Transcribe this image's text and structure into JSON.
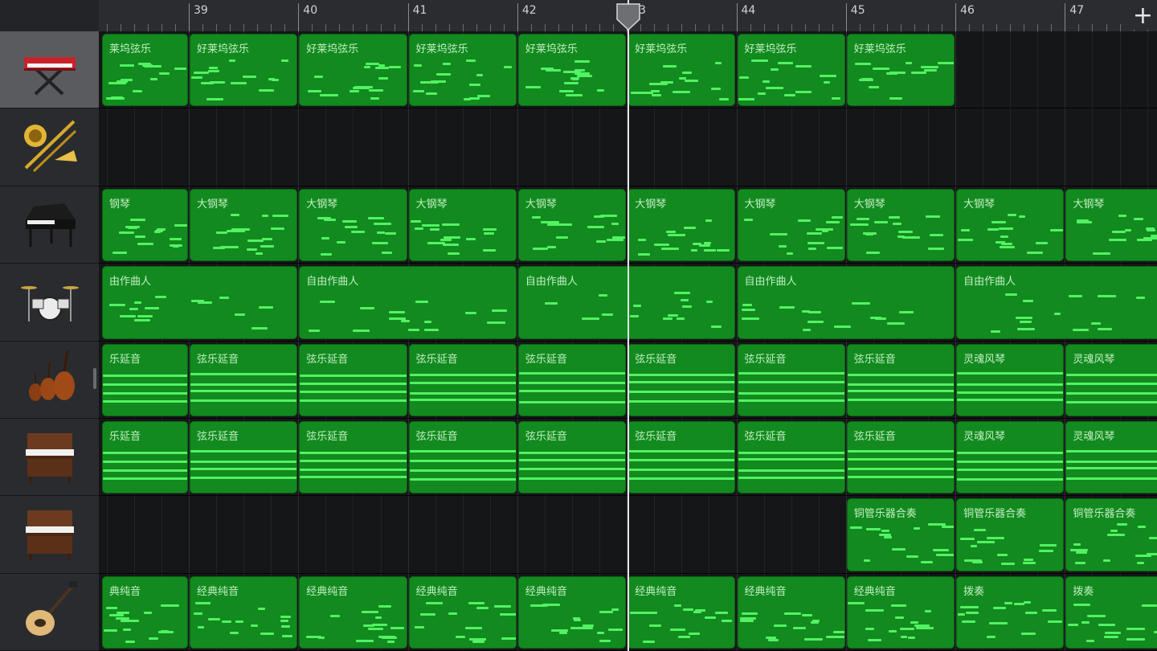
{
  "header": {
    "add_label": "+"
  },
  "ruler": {
    "bars": [
      "39",
      "40",
      "41",
      "42",
      "43",
      "44",
      "45",
      "46",
      "47"
    ]
  },
  "tracks": [
    {
      "icon": "keyboard-stand-icon",
      "selected": true
    },
    {
      "icon": "brass-instruments-icon",
      "selected": false
    },
    {
      "icon": "grand-piano-icon",
      "selected": false
    },
    {
      "icon": "drum-kit-icon",
      "selected": false
    },
    {
      "icon": "string-ensemble-icon",
      "selected": false
    },
    {
      "icon": "organ-icon",
      "selected": false
    },
    {
      "icon": "organ-icon",
      "selected": false
    },
    {
      "icon": "electric-guitar-icon",
      "selected": false
    }
  ],
  "regions": [
    [
      {
        "label": "莱坞弦乐",
        "start": 38.2,
        "end": 39
      },
      {
        "label": "好莱坞弦乐",
        "start": 39,
        "end": 40
      },
      {
        "label": "好莱坞弦乐",
        "start": 40,
        "end": 41
      },
      {
        "label": "好莱坞弦乐",
        "start": 41,
        "end": 42
      },
      {
        "label": "好莱坞弦乐",
        "start": 42,
        "end": 43
      },
      {
        "label": "好莱坞弦乐",
        "start": 43,
        "end": 44
      },
      {
        "label": "好莱坞弦乐",
        "start": 44,
        "end": 45
      },
      {
        "label": "好莱坞弦乐",
        "start": 45,
        "end": 46
      }
    ],
    [],
    [
      {
        "label": "钢琴",
        "start": 38.2,
        "end": 39
      },
      {
        "label": "大钢琴",
        "start": 39,
        "end": 40
      },
      {
        "label": "大钢琴",
        "start": 40,
        "end": 41
      },
      {
        "label": "大钢琴",
        "start": 41,
        "end": 42
      },
      {
        "label": "大钢琴",
        "start": 42,
        "end": 43
      },
      {
        "label": "大钢琴",
        "start": 43,
        "end": 44
      },
      {
        "label": "大钢琴",
        "start": 44,
        "end": 45
      },
      {
        "label": "大钢琴",
        "start": 45,
        "end": 46
      },
      {
        "label": "大钢琴",
        "start": 46,
        "end": 47
      },
      {
        "label": "大钢琴",
        "start": 47,
        "end": 48
      }
    ],
    [
      {
        "label": "由作曲人",
        "start": 38.2,
        "end": 40
      },
      {
        "label": "自由作曲人",
        "start": 40,
        "end": 42
      },
      {
        "label": "自由作曲人",
        "start": 42,
        "end": 44
      },
      {
        "label": "自由作曲人",
        "start": 44,
        "end": 46
      },
      {
        "label": "自由作曲人",
        "start": 46,
        "end": 48
      }
    ],
    [
      {
        "label": "乐延音",
        "start": 38.2,
        "end": 39
      },
      {
        "label": "弦乐延音",
        "start": 39,
        "end": 40
      },
      {
        "label": "弦乐延音",
        "start": 40,
        "end": 41
      },
      {
        "label": "弦乐延音",
        "start": 41,
        "end": 42
      },
      {
        "label": "弦乐延音",
        "start": 42,
        "end": 43
      },
      {
        "label": "弦乐延音",
        "start": 43,
        "end": 44
      },
      {
        "label": "弦乐延音",
        "start": 44,
        "end": 45
      },
      {
        "label": "弦乐延音",
        "start": 45,
        "end": 46
      },
      {
        "label": "灵魂风琴",
        "start": 46,
        "end": 47
      },
      {
        "label": "灵魂风琴",
        "start": 47,
        "end": 48
      }
    ],
    [
      {
        "label": "乐延音",
        "start": 38.2,
        "end": 39
      },
      {
        "label": "弦乐延音",
        "start": 39,
        "end": 40
      },
      {
        "label": "弦乐延音",
        "start": 40,
        "end": 41
      },
      {
        "label": "弦乐延音",
        "start": 41,
        "end": 42
      },
      {
        "label": "弦乐延音",
        "start": 42,
        "end": 43
      },
      {
        "label": "弦乐延音",
        "start": 43,
        "end": 44
      },
      {
        "label": "弦乐延音",
        "start": 44,
        "end": 45
      },
      {
        "label": "弦乐延音",
        "start": 45,
        "end": 46
      },
      {
        "label": "灵魂风琴",
        "start": 46,
        "end": 47
      },
      {
        "label": "灵魂风琴",
        "start": 47,
        "end": 48
      }
    ],
    [
      {
        "label": "铜管乐器合奏",
        "start": 45,
        "end": 46
      },
      {
        "label": "铜管乐器合奏",
        "start": 46,
        "end": 47
      },
      {
        "label": "铜管乐器合奏",
        "start": 47,
        "end": 48
      }
    ],
    [
      {
        "label": "典纯音",
        "start": 38.2,
        "end": 39
      },
      {
        "label": "经典纯音",
        "start": 39,
        "end": 40
      },
      {
        "label": "经典纯音",
        "start": 40,
        "end": 41
      },
      {
        "label": "经典纯音",
        "start": 41,
        "end": 42
      },
      {
        "label": "经典纯音",
        "start": 42,
        "end": 43
      },
      {
        "label": "经典纯音",
        "start": 43,
        "end": 44
      },
      {
        "label": "经典纯音",
        "start": 44,
        "end": 45
      },
      {
        "label": "经典纯音",
        "start": 45,
        "end": 46
      },
      {
        "label": "拨奏",
        "start": 46,
        "end": 47
      },
      {
        "label": "拨奏",
        "start": 47,
        "end": 48
      }
    ]
  ],
  "playhead_bar": 43.05,
  "colors": {
    "region": "#128a1f",
    "note": "#52f262",
    "region_text": "#c4efc4",
    "background": "#151618"
  }
}
